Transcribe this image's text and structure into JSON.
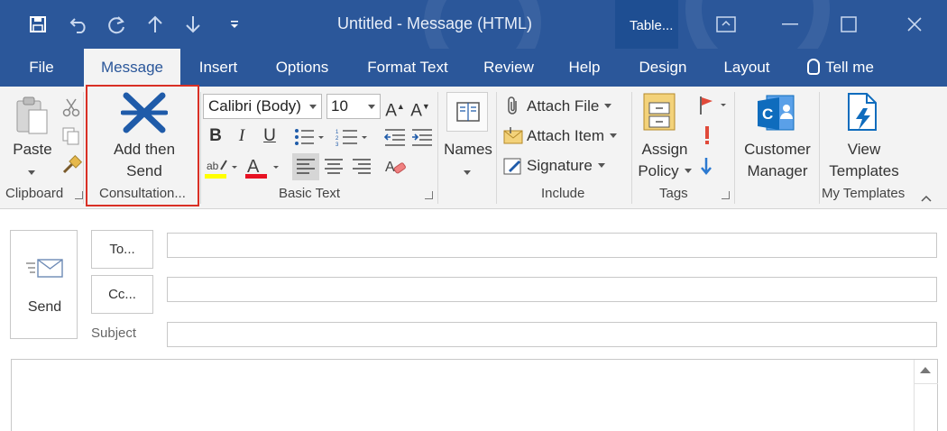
{
  "window": {
    "title": "Untitled  -  Message (HTML)",
    "context_tab": "Table...",
    "accent_color": "#2b579a",
    "quick_access_icons": [
      "save-icon",
      "undo-icon",
      "redo-icon",
      "up-arrow-icon",
      "down-arrow-icon",
      "customize-icon"
    ],
    "window_icons": [
      "ribbon-display-icon",
      "minimize-icon",
      "maximize-icon",
      "close-icon"
    ]
  },
  "tabs": [
    {
      "label": "File",
      "active": false
    },
    {
      "label": "Message",
      "active": true
    },
    {
      "label": "Insert",
      "active": false
    },
    {
      "label": "Options",
      "active": false
    },
    {
      "label": "Format Text",
      "active": false
    },
    {
      "label": "Review",
      "active": false
    },
    {
      "label": "Help",
      "active": false
    },
    {
      "label": "Design",
      "active": false
    },
    {
      "label": "Layout",
      "active": false
    },
    {
      "label": "Tell me",
      "active": false
    }
  ],
  "ribbon": {
    "clipboard": {
      "group_label": "Clipboard",
      "paste": "Paste"
    },
    "consultation": {
      "group_label": "Consultation...",
      "add_then_send": "Add then\nSend",
      "line1": "Add then",
      "line2": "Send"
    },
    "basic_text": {
      "group_label": "Basic Text",
      "font_name": "Calibri (Body)",
      "font_size": "10",
      "bold": "B",
      "italic": "I",
      "underline": "U"
    },
    "names": {
      "label": "Names"
    },
    "include": {
      "group_label": "Include",
      "attach_file": "Attach File",
      "attach_item": "Attach Item",
      "signature": "Signature"
    },
    "tags": {
      "group_label": "Tags",
      "assign_policy_line1": "Assign",
      "assign_policy_line2": "Policy"
    },
    "customer_manager": {
      "line1": "Customer",
      "line2": "Manager"
    },
    "my_templates": {
      "group_label": "My Templates",
      "line1": "View",
      "line2": "Templates"
    },
    "colors": {
      "highlight": "#ffff00",
      "font_color": "#e81123",
      "consultation_icon": "#1f5ba9",
      "customer_manager_icon": "#0f6cbd"
    }
  },
  "compose": {
    "send": "Send",
    "to": "To...",
    "cc": "Cc...",
    "subject": "Subject",
    "to_value": "",
    "cc_value": "",
    "subject_value": ""
  }
}
